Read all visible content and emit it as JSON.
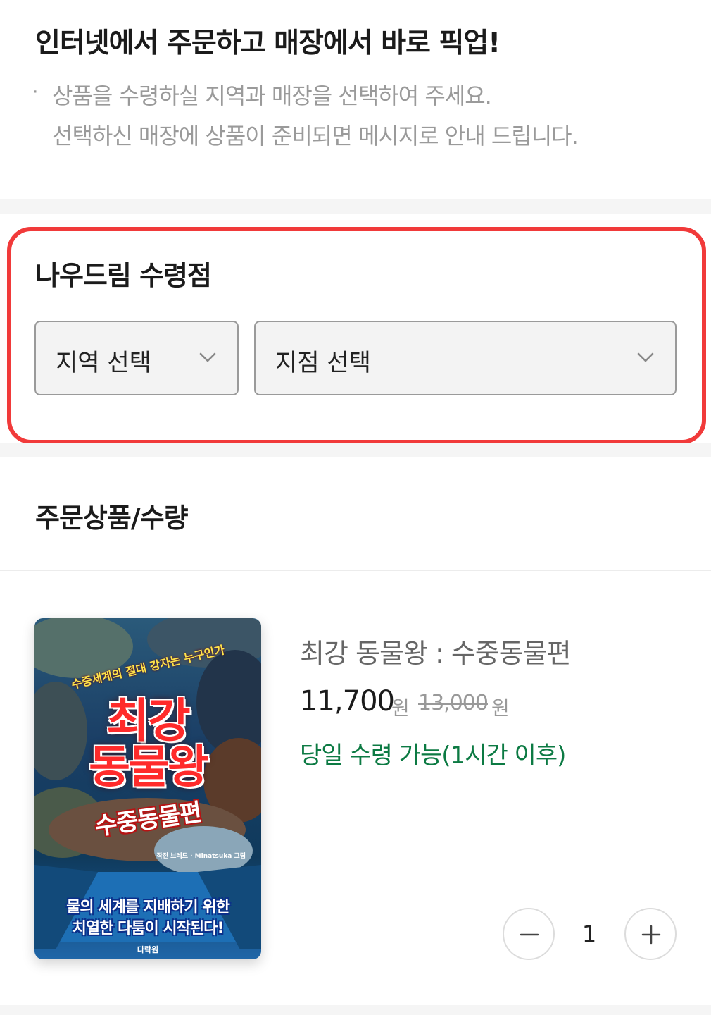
{
  "intro": {
    "title": "인터넷에서 주문하고 매장에서 바로 픽업!",
    "bullet": "·",
    "line1": "상품을 수령하실 지역과 매장을 선택하여 주세요.",
    "line2": "선택하신 매장에 상품이 준비되면 메시지로 안내 드립니다."
  },
  "store": {
    "title": "나우드림 수령점",
    "region_select": "지역 선택",
    "branch_select": "지점 선택",
    "highlight_color": "#f13a3a"
  },
  "order": {
    "title": "주문상품/수량"
  },
  "product": {
    "cover": {
      "tag": "수중세계의 절대 강자는 누구인가",
      "title_line1": "최강",
      "title_line2": "동물왕",
      "subtitle": "수중동물편",
      "author": "작전 브레드 · Minatsuka 그림",
      "tagline1": "물의 세계를 지배하기 위한",
      "tagline2": "치열한 다툼이 시작된다!",
      "publisher": "다락원"
    },
    "title": "최강 동물왕 : 수중동물편",
    "price": "11,700",
    "price_unit": "원",
    "original_price": "13,000",
    "original_unit": "원",
    "availability": "당일 수령 가능(1시간 이후)",
    "availability_color": "#0c7a43",
    "quantity": "1"
  },
  "icons": {
    "dropdown": "chevron-down-icon",
    "minus": "minus-icon",
    "plus": "plus-icon"
  }
}
